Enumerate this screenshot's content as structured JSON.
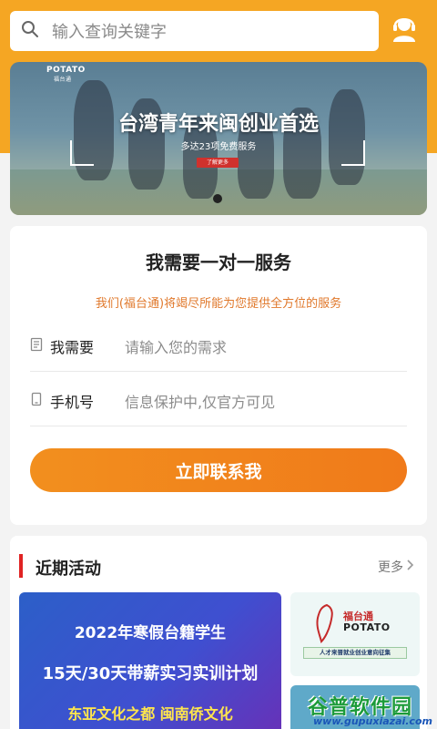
{
  "search": {
    "placeholder": "输入查询关键字"
  },
  "banner": {
    "logo": "POTATO",
    "logo_sub": "福台通",
    "title": "台湾青年来闽创业首选",
    "subtitle": "多达23项免费服务",
    "more_chip": "了解更多",
    "active_slide": 1,
    "slide_count": 1
  },
  "service": {
    "heading": "我需要一对一服务",
    "description": "我们(福台通)将竭尽所能为您提供全方位的服务",
    "need_label": "我需要",
    "need_placeholder": "请输入您的需求",
    "phone_label": "手机号",
    "phone_placeholder": "信息保护中,仅官方可见",
    "contact_button": "立即联系我"
  },
  "activities": {
    "title": "近期活动",
    "more": "更多",
    "main_poster": {
      "line1": "2022年寒假台籍学生",
      "line2": "15天/30天带薪实习实训计划",
      "line3": "东亚文化之都  闽南侨文化"
    },
    "side_poster": {
      "name": "福台通",
      "brand": "POTATO",
      "caption": "人才来晋就业创业意向征集"
    }
  },
  "watermark": {
    "text": "谷普软件园",
    "url": "www.gupuxiazai.com"
  },
  "colors": {
    "accent": "#f5a623",
    "button": "#f07a1a",
    "desc": "#e0782b",
    "section_bar": "#e02323"
  }
}
